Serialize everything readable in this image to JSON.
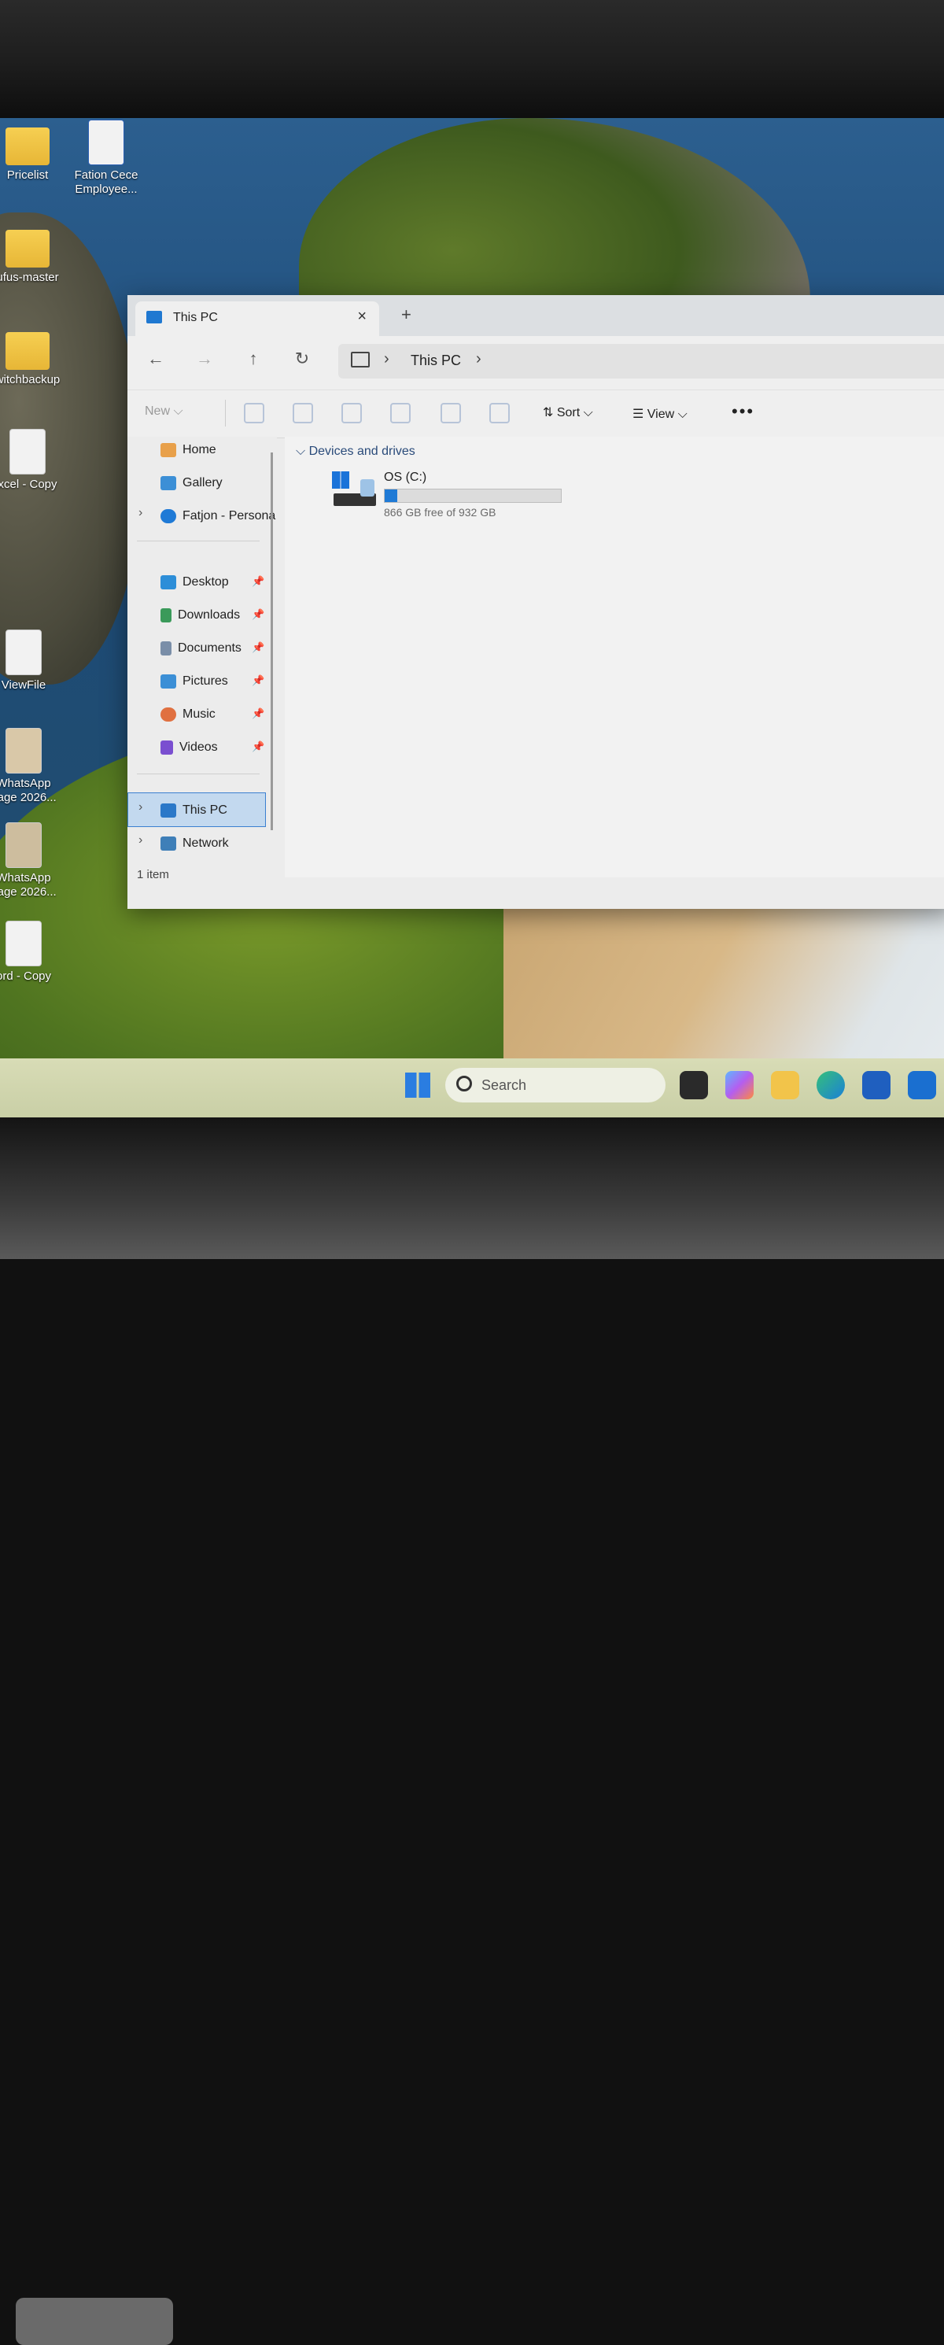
{
  "desktop": {
    "icons": [
      {
        "label": "Pricelist"
      },
      {
        "label": "Fation Cece Employee..."
      },
      {
        "label": "ufus-master"
      },
      {
        "label": "witchbackup"
      },
      {
        "label": "xcel - Copy"
      },
      {
        "label": "ViewFile"
      },
      {
        "label": "WhatsApp nage 2026..."
      },
      {
        "label": "WhatsApp nage 2026..."
      },
      {
        "label": "ord - Copy"
      }
    ]
  },
  "window": {
    "tab_title": "This PC",
    "tab_close": "×",
    "tab_add": "+",
    "nav": {
      "back": "←",
      "forward": "→",
      "up": "↑",
      "refresh": "↻"
    },
    "breadcrumb": {
      "sep": "›",
      "current": "This PC"
    }
  },
  "toolbar": {
    "new_label": "New ⌵",
    "sort_label": "⇅ Sort ⌵",
    "view_label": "☰ View ⌵",
    "more_label": "•••"
  },
  "sidebar": {
    "items": [
      {
        "label": "Home"
      },
      {
        "label": "Gallery"
      },
      {
        "label": "Fatjon - Persona"
      },
      {
        "label": "Desktop"
      },
      {
        "label": "Downloads"
      },
      {
        "label": "Documents"
      },
      {
        "label": "Pictures"
      },
      {
        "label": "Music"
      },
      {
        "label": "Videos"
      },
      {
        "label": "This PC"
      },
      {
        "label": "Network"
      }
    ],
    "pin_glyph": "📌"
  },
  "main": {
    "group_label": "Devices and drives",
    "group_chevron": "⌵",
    "drive": {
      "name": "OS (C:)",
      "free_text": "866 GB free of 932 GB",
      "used_fraction": 0.071
    }
  },
  "status": {
    "text": "1 item"
  },
  "taskbar": {
    "search_placeholder": "Search"
  },
  "colors": {
    "accent": "#1f7ad6",
    "selection_bg": "#c3d9ef"
  }
}
